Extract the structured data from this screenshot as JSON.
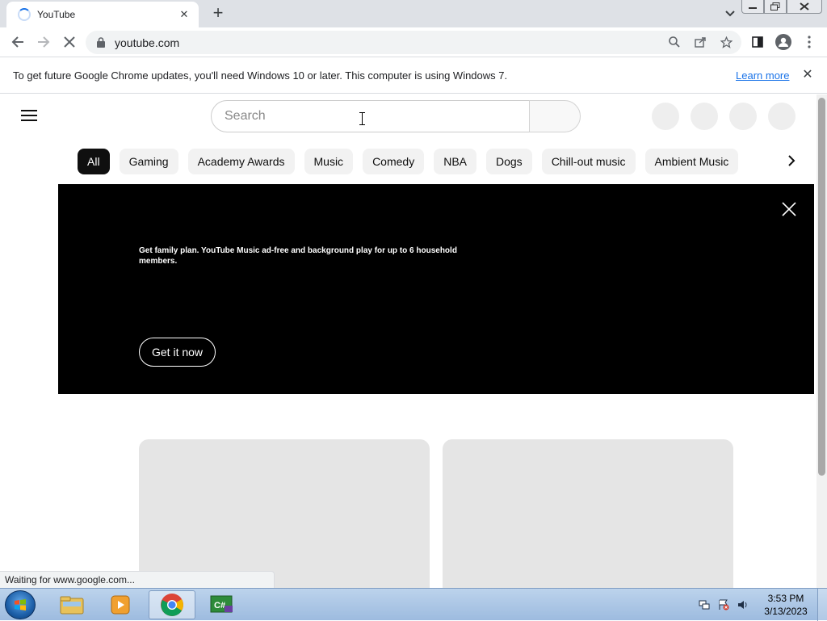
{
  "browser": {
    "tab": {
      "title": "YouTube",
      "close_glyph": "✕"
    },
    "new_tab_glyph": "+",
    "url": "youtube.com",
    "infobar": {
      "message": "To get future Google Chrome updates, you'll need Windows 10 or later. This computer is using Windows 7.",
      "link_label": "Learn more",
      "close_glyph": "✕"
    },
    "status_text": "Waiting for www.google.com..."
  },
  "youtube": {
    "search_placeholder": "Search",
    "chips": [
      "All",
      "Gaming",
      "Academy Awards",
      "Music",
      "Comedy",
      "NBA",
      "Dogs",
      "Chill-out music",
      "Ambient Music"
    ],
    "active_chip": "All",
    "banner": {
      "text": "Get family plan. YouTube Music ad-free and background play for up to 6 household members.",
      "button_label": "Get it now"
    }
  },
  "taskbar": {
    "clock_time": "3:53 PM",
    "clock_date": "3/13/2023"
  },
  "colors": {
    "accent": "#1a73e8",
    "banner_bg": "#000000",
    "chip_active_bg": "#0f0f0f",
    "chip_bg": "#f2f2f2",
    "placeholder_bg": "#e5e5e5"
  }
}
